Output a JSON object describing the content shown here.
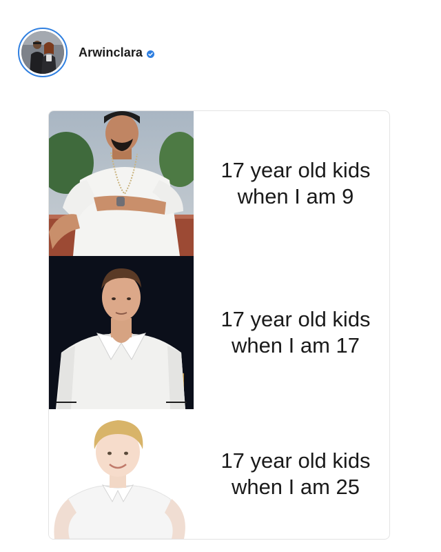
{
  "post": {
    "username": "Arwinclara",
    "verified": true,
    "accent_color": "#2f7fe0"
  },
  "meme": {
    "panels": [
      {
        "line1": "17 year old kids",
        "line2": "when I am 9",
        "photo_icon": "man-in-white-kurta-photo"
      },
      {
        "line1": "17 year old kids",
        "line2": "when I am 17",
        "photo_icon": "young-man-white-shirt-photo"
      },
      {
        "line1": "17 year old kids",
        "line2": "when I am 25",
        "photo_icon": "child-white-shirt-photo"
      }
    ]
  }
}
